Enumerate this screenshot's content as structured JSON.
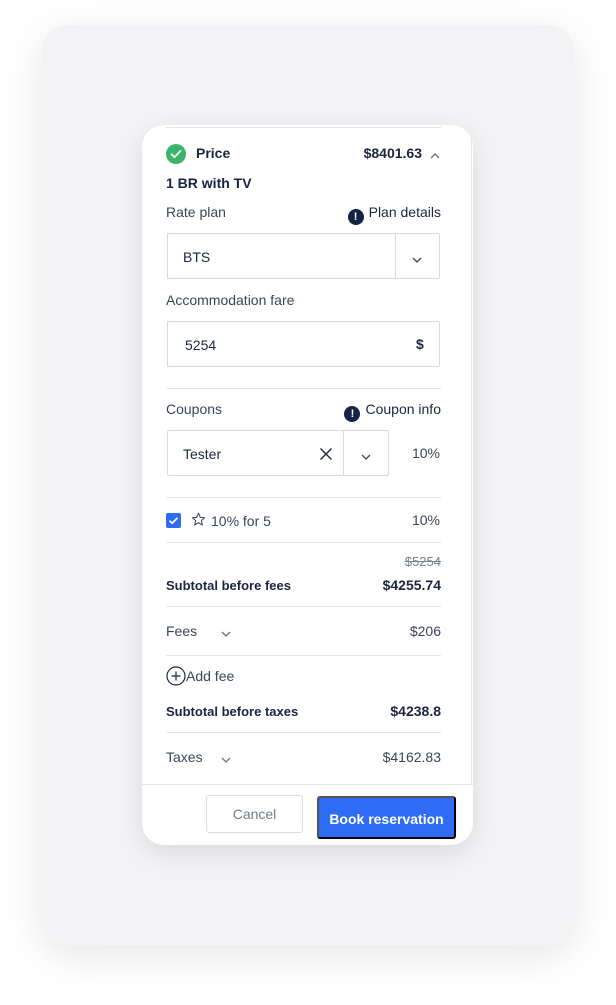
{
  "price_section": {
    "title": "Price",
    "total": "$8401.63",
    "status_color": "#3bb36a",
    "room_name": "1 BR with TV"
  },
  "rate_plan": {
    "label": "Rate plan",
    "details_link": "Plan details",
    "selected": "BTS"
  },
  "accommodation_fare": {
    "label": "Accommodation fare",
    "value": "5254",
    "currency_symbol": "$"
  },
  "coupons": {
    "label": "Coupons",
    "info_link": "Coupon info",
    "selected": "Tester",
    "percent": "10%"
  },
  "discount": {
    "checked": true,
    "label": "10% for 5",
    "value": "10%"
  },
  "subtotal_fees": {
    "original": "$5254",
    "label": "Subtotal before fees",
    "value": "$4255.74"
  },
  "fees": {
    "label": "Fees",
    "value": "$206",
    "add_label": "Add fee"
  },
  "subtotal_taxes": {
    "label": "Subtotal before taxes",
    "value": "$4238.8"
  },
  "taxes": {
    "label": "Taxes",
    "value": "$4162.83"
  },
  "footer": {
    "cancel_label": "Cancel",
    "book_label": "Book reservation",
    "accent": "#2e6cf6"
  }
}
